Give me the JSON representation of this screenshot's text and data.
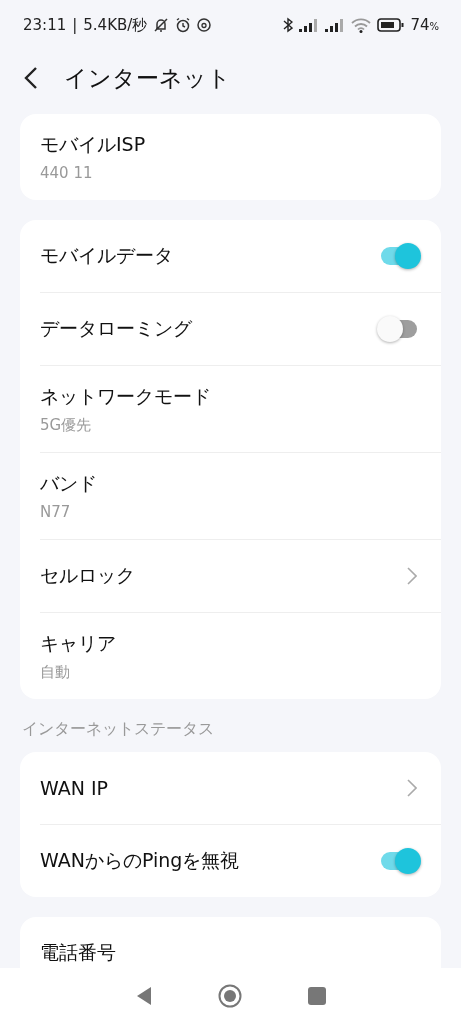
{
  "status_bar": {
    "time": "23:11",
    "separator": "|",
    "speed": "5.4KB/秒",
    "battery": "74",
    "battery_unit": "%"
  },
  "header": {
    "title": "インターネット"
  },
  "sections": [
    {
      "items": [
        {
          "kind": "value",
          "title": "モバイルISP",
          "value": "440 11"
        }
      ]
    },
    {
      "items": [
        {
          "kind": "toggle",
          "title": "モバイルデータ",
          "on": true
        },
        {
          "kind": "toggle",
          "title": "データローミング",
          "on": false
        },
        {
          "kind": "value",
          "title": "ネットワークモード",
          "value": "5G優先"
        },
        {
          "kind": "value",
          "title": "バンド",
          "value": "N77"
        },
        {
          "kind": "link",
          "title": "セルロック"
        },
        {
          "kind": "value",
          "title": "キャリア",
          "value": "自動"
        }
      ]
    },
    {
      "heading": "インターネットステータス",
      "items": [
        {
          "kind": "link",
          "title": "WAN IP"
        },
        {
          "kind": "toggle",
          "title": "WANからのPingを無視",
          "on": true
        }
      ]
    },
    {
      "items": [
        {
          "kind": "plain",
          "title": "電話番号"
        }
      ]
    }
  ]
}
